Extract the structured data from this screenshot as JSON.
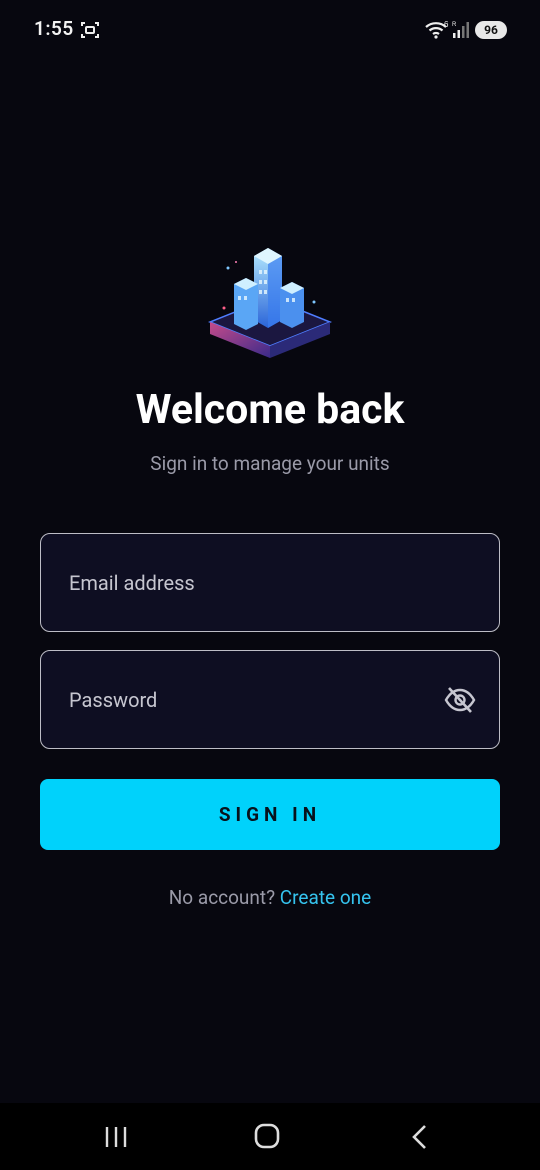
{
  "status_bar": {
    "time": "1:55",
    "battery": "96",
    "icons": [
      "screenshot-icon",
      "wifi-icon",
      "signal-icon",
      "battery-icon"
    ]
  },
  "logo": {
    "icon": "isometric-buildings-logo"
  },
  "title": "Welcome back",
  "subtitle": "Sign in to manage your units",
  "form": {
    "email_placeholder": "Email address",
    "password_placeholder": "Password",
    "password_toggle_icon": "eye-off-icon",
    "submit_label": "SIGN IN"
  },
  "signup": {
    "prompt": "No account?",
    "link": "Create one"
  },
  "nav_bar": {
    "icons": [
      "recents-icon",
      "home-icon",
      "back-icon"
    ]
  },
  "colors": {
    "background": "#07070f",
    "accent": "#00d2fb",
    "link": "#35c3ee",
    "field_background": "#0e0e22"
  }
}
